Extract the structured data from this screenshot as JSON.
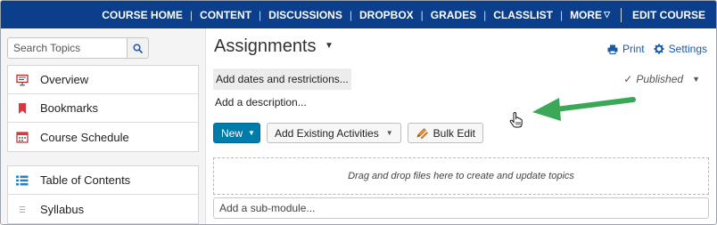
{
  "topnav": {
    "items": [
      "COURSE HOME",
      "CONTENT",
      "DISCUSSIONS",
      "DROPBOX",
      "GRADES",
      "CLASSLIST",
      "MORE",
      "EDIT COURSE"
    ]
  },
  "sidebar": {
    "search_placeholder": "Search Topics",
    "group1": [
      {
        "label": "Overview",
        "icon": "overview-icon"
      },
      {
        "label": "Bookmarks",
        "icon": "bookmark-icon"
      },
      {
        "label": "Course Schedule",
        "icon": "calendar-icon"
      }
    ],
    "group2": [
      {
        "label": "Table of Contents",
        "icon": "list-icon"
      },
      {
        "label": "Syllabus",
        "icon": "drag-handle-icon"
      }
    ]
  },
  "main": {
    "title": "Assignments",
    "print_label": "Print",
    "settings_label": "Settings",
    "dates_link": "Add dates and restrictions...",
    "status": "Published",
    "desc_link": "Add a description...",
    "new_button": "New",
    "add_existing_button": "Add Existing Activities",
    "bulk_edit_button": "Bulk Edit",
    "dropzone_text": "Drag and drop files here to create and update topics",
    "submodule_placeholder": "Add a sub-module..."
  },
  "colors": {
    "nav_bg": "#0b3f8c",
    "primary_button": "#007cac",
    "link": "#1a5aa8",
    "annotation_arrow": "#3aa857"
  }
}
